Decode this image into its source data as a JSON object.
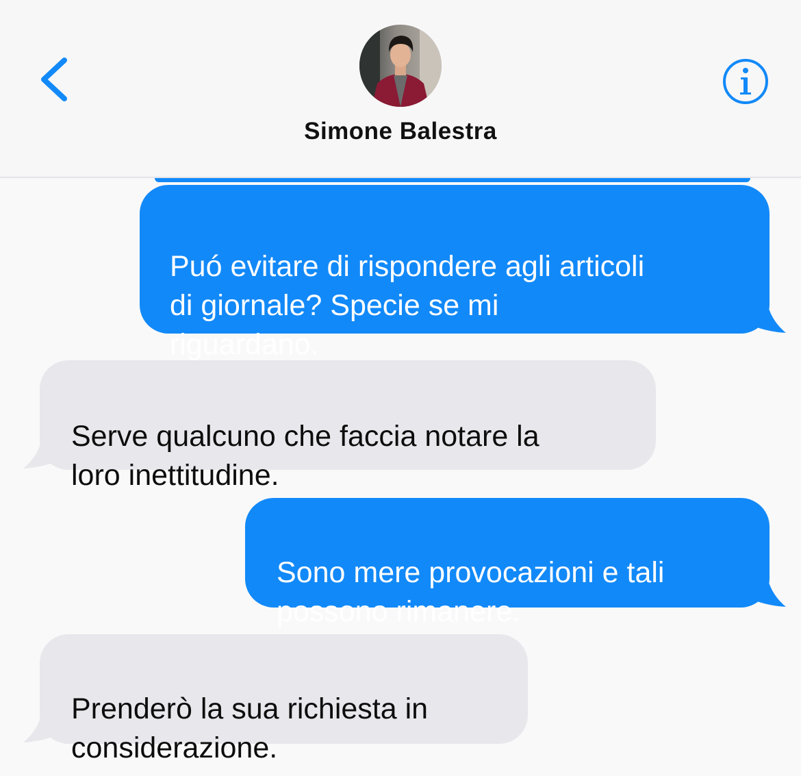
{
  "header": {
    "contact_name": "Simone Balestra"
  },
  "icons": {
    "back": "chevron-left-icon",
    "info": "info-circle-icon"
  },
  "colors": {
    "accent": "#1289f8",
    "outgoing_bubble": "#1289f8",
    "incoming_bubble": "#e8e7ec",
    "header_bg": "#f7f7f8",
    "thread_bg": "#f9f9f9"
  },
  "messages": [
    {
      "direction": "outgoing",
      "text": "Puó evitare di rispondere agli articoli\ndi giornale? Specie se mi\nriguardano."
    },
    {
      "direction": "incoming",
      "text": "Serve qualcuno che faccia notare la\nloro inettitudine."
    },
    {
      "direction": "outgoing",
      "text": "Sono mere provocazioni e tali\npossono rimanere."
    },
    {
      "direction": "incoming",
      "text": "Prenderò la sua richiesta in\nconsiderazione."
    }
  ]
}
